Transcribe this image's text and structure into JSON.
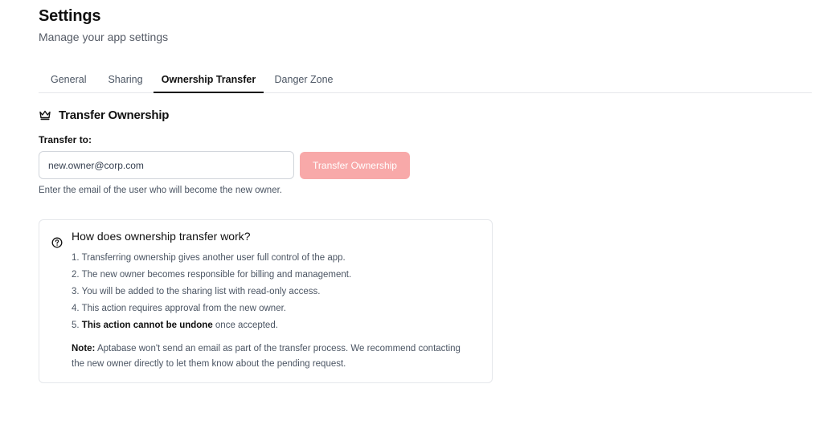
{
  "header": {
    "title": "Settings",
    "subtitle": "Manage your app settings"
  },
  "tabs": [
    {
      "label": "General",
      "active": false
    },
    {
      "label": "Sharing",
      "active": false
    },
    {
      "label": "Ownership Transfer",
      "active": true
    },
    {
      "label": "Danger Zone",
      "active": false
    }
  ],
  "section": {
    "icon": "crown-icon",
    "title": "Transfer Ownership"
  },
  "form": {
    "label": "Transfer to:",
    "email_value": "new.owner@corp.com",
    "button_label": "Transfer Ownership",
    "help": "Enter the email of the user who will become the new owner."
  },
  "info": {
    "icon": "help-circle-icon",
    "heading": "How does ownership transfer work?",
    "items": [
      "1. Transferring ownership gives another user full control of the app.",
      "2. The new owner becomes responsible for billing and management.",
      "3. You will be added to the sharing list with read-only access.",
      "4. This action requires approval from the new owner."
    ],
    "item5_prefix": "5. ",
    "item5_bold": "This action cannot be undone",
    "item5_suffix": " once accepted.",
    "note_label": "Note:",
    "note_text": " Aptabase won't send an email as part of the transfer process. We recommend contacting the new owner directly to let them know about the pending request."
  },
  "colors": {
    "button_disabled_bg": "#f8a9a9",
    "active_tab_underline": "#111111",
    "border": "#e5e7eb"
  }
}
